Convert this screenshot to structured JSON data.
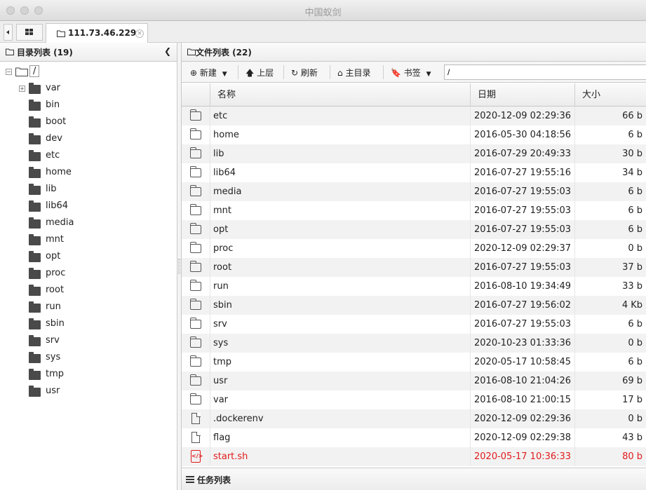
{
  "window": {
    "title": "中国蚁剑"
  },
  "tabs": [
    {
      "label": "111.73.46.229"
    }
  ],
  "left_panel": {
    "header": "目录列表 (19)",
    "root_label": "/",
    "tree": [
      "var",
      "bin",
      "boot",
      "dev",
      "etc",
      "home",
      "lib",
      "lib64",
      "media",
      "mnt",
      "opt",
      "proc",
      "root",
      "run",
      "sbin",
      "srv",
      "sys",
      "tmp",
      "usr"
    ]
  },
  "right_panel": {
    "header": "文件列表 (22)",
    "toolbar": {
      "new_label": "新建",
      "up_label": "上层",
      "refresh_label": "刷新",
      "home_label": "主目录",
      "bookmark_label": "书签",
      "path_value": "/"
    },
    "columns": {
      "name": "名称",
      "date": "日期",
      "size": "大小"
    },
    "files": [
      {
        "name": "etc",
        "date": "2020-12-09 02:29:36",
        "size": "66 b",
        "type": "folder"
      },
      {
        "name": "home",
        "date": "2016-05-30 04:18:56",
        "size": "6 b",
        "type": "folder"
      },
      {
        "name": "lib",
        "date": "2016-07-29 20:49:33",
        "size": "30 b",
        "type": "folder"
      },
      {
        "name": "lib64",
        "date": "2016-07-27 19:55:16",
        "size": "34 b",
        "type": "folder"
      },
      {
        "name": "media",
        "date": "2016-07-27 19:55:03",
        "size": "6 b",
        "type": "folder"
      },
      {
        "name": "mnt",
        "date": "2016-07-27 19:55:03",
        "size": "6 b",
        "type": "folder"
      },
      {
        "name": "opt",
        "date": "2016-07-27 19:55:03",
        "size": "6 b",
        "type": "folder"
      },
      {
        "name": "proc",
        "date": "2020-12-09 02:29:37",
        "size": "0 b",
        "type": "folder"
      },
      {
        "name": "root",
        "date": "2016-07-27 19:55:03",
        "size": "37 b",
        "type": "folder"
      },
      {
        "name": "run",
        "date": "2016-08-10 19:34:49",
        "size": "33 b",
        "type": "folder"
      },
      {
        "name": "sbin",
        "date": "2016-07-27 19:56:02",
        "size": "4 Kb",
        "type": "folder"
      },
      {
        "name": "srv",
        "date": "2016-07-27 19:55:03",
        "size": "6 b",
        "type": "folder"
      },
      {
        "name": "sys",
        "date": "2020-10-23 01:33:36",
        "size": "0 b",
        "type": "folder"
      },
      {
        "name": "tmp",
        "date": "2020-05-17 10:58:45",
        "size": "6 b",
        "type": "folder"
      },
      {
        "name": "usr",
        "date": "2016-08-10 21:04:26",
        "size": "69 b",
        "type": "folder"
      },
      {
        "name": "var",
        "date": "2016-08-10 21:00:15",
        "size": "17 b",
        "type": "folder"
      },
      {
        "name": ".dockerenv",
        "date": "2020-12-09 02:29:36",
        "size": "0 b",
        "type": "file"
      },
      {
        "name": "flag",
        "date": "2020-12-09 02:29:38",
        "size": "43 b",
        "type": "file"
      },
      {
        "name": "start.sh",
        "date": "2020-05-17 10:36:33",
        "size": "80 b",
        "type": "script"
      }
    ]
  },
  "task_panel": {
    "label": "任务列表"
  },
  "colors": {
    "script_highlight": "#e21b1b"
  }
}
